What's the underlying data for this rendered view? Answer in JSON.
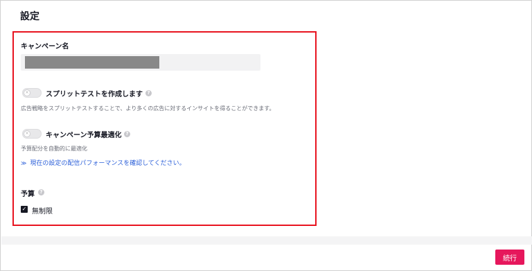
{
  "page": {
    "title": "設定"
  },
  "campaign_name": {
    "label": "キャンペーン名",
    "value": ""
  },
  "split_test": {
    "label": "スプリットテストを作成します",
    "description": "広告戦略をスプリットテストすることで、より多くの広告に対するインサイトを得ることができます。",
    "enabled": false
  },
  "budget_optimization": {
    "label": "キャンペーン予算最適化",
    "description": "予算配分を自動的に最適化",
    "link_text": "現在の設定の配信パフォーマンスを確認してください。",
    "link_icon": "double-chevron-down-icon",
    "enabled": false
  },
  "budget": {
    "label": "予算",
    "unlimited_label": "無制限",
    "unlimited_checked": true
  },
  "footer": {
    "next_label": "続行"
  },
  "colors": {
    "accent": "#e6175c",
    "highlight": "#e8131f",
    "link": "#2b5fd9"
  }
}
